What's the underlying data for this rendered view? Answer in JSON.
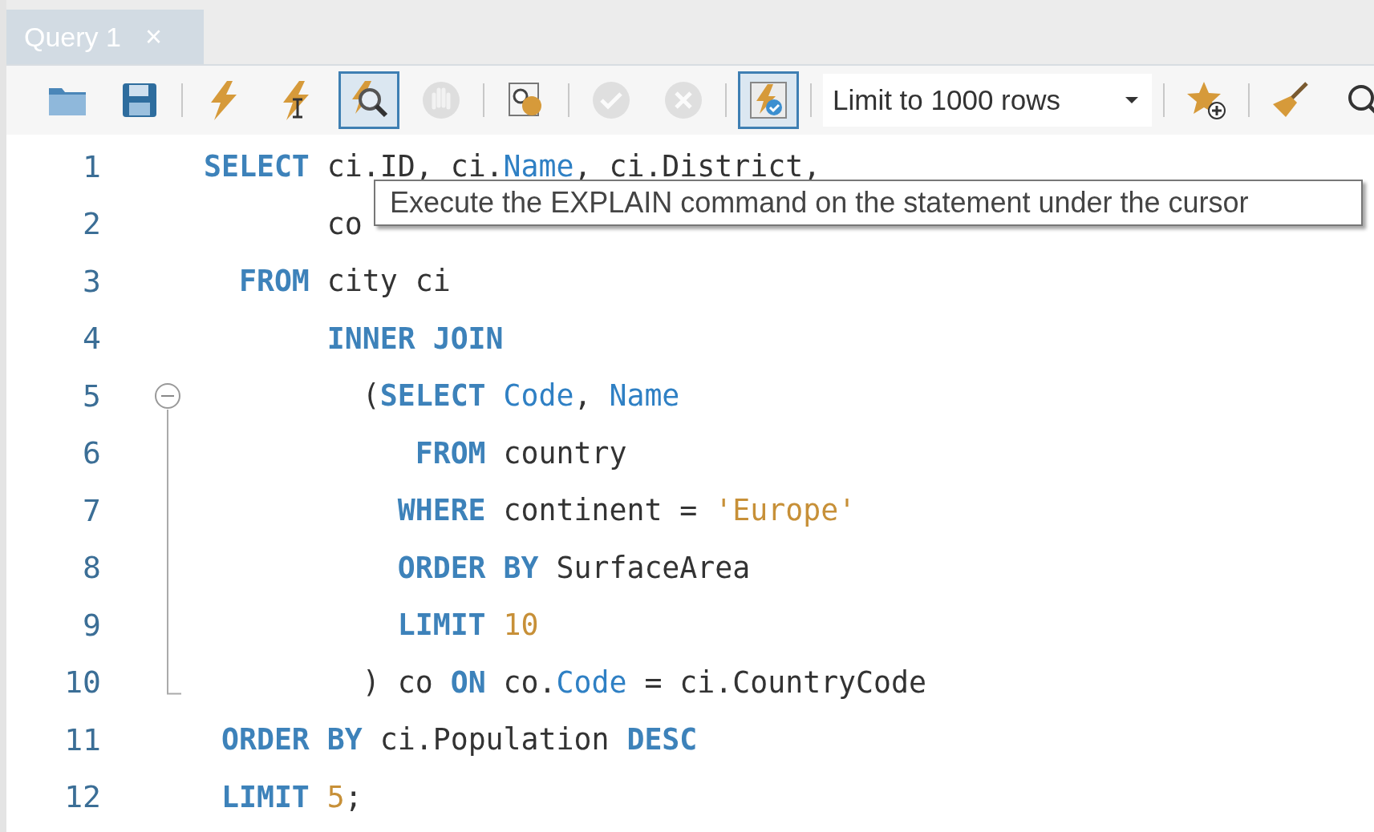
{
  "tabs": [
    {
      "label": "Query 1",
      "close": "×",
      "selected": true
    }
  ],
  "toolbar": [
    {
      "kind": "button",
      "selected": false,
      "disabled": false
    },
    {
      "kind": "button",
      "selected": false,
      "disabled": false
    },
    {
      "kind": "separator"
    },
    {
      "kind": "button",
      "selected": false,
      "disabled": false
    },
    {
      "kind": "button",
      "selected": false,
      "disabled": false
    },
    {
      "kind": "button",
      "selected": true,
      "disabled": false
    },
    {
      "kind": "button",
      "selected": false,
      "disabled": true
    },
    {
      "kind": "separator"
    },
    {
      "kind": "button",
      "selected": false,
      "disabled": false
    },
    {
      "kind": "separator"
    },
    {
      "kind": "button",
      "selected": false,
      "disabled": true
    },
    {
      "kind": "button",
      "selected": false,
      "disabled": true
    },
    {
      "kind": "separator"
    },
    {
      "kind": "button",
      "selected": true,
      "disabled": false
    },
    {
      "kind": "separator"
    },
    {
      "kind": "dropdown",
      "value": "Limit to 1000 rows"
    },
    {
      "kind": "separator"
    },
    {
      "kind": "button",
      "selected": false,
      "disabled": false
    },
    {
      "kind": "separator"
    },
    {
      "kind": "button",
      "selected": false,
      "disabled": false
    },
    {
      "kind": "button",
      "selected": false,
      "disabled": false
    }
  ],
  "editor": {
    "lines": [
      {
        "number": "1",
        "tokens": [
          {
            "kind": "keyword",
            "text": "SELECT"
          },
          {
            "kind": "text",
            "text": " ci.ID, ci."
          },
          {
            "kind": "column",
            "text": "Name"
          },
          {
            "kind": "text",
            "text": ", ci.District,"
          }
        ]
      },
      {
        "number": "2",
        "tokens": [
          {
            "kind": "text",
            "text": "       co"
          }
        ]
      },
      {
        "number": "3",
        "tokens": [
          {
            "kind": "keyword",
            "text": "  FROM"
          },
          {
            "kind": "text",
            "text": " city ci"
          }
        ]
      },
      {
        "number": "4",
        "tokens": [
          {
            "kind": "keyword",
            "text": "       INNER JOIN"
          }
        ]
      },
      {
        "number": "5",
        "expanded": true,
        "tokens": [
          {
            "kind": "text",
            "text": "         ("
          },
          {
            "kind": "keyword",
            "text": "SELECT"
          },
          {
            "kind": "column",
            "text": " Code"
          },
          {
            "kind": "text",
            "text": ", "
          },
          {
            "kind": "column",
            "text": "Name"
          }
        ],
        "children": [
          {
            "number": "6",
            "tokens": [
              {
                "kind": "keyword",
                "text": "            FROM"
              },
              {
                "kind": "text",
                "text": " country"
              }
            ]
          },
          {
            "number": "7",
            "tokens": [
              {
                "kind": "keyword",
                "text": "           WHERE"
              },
              {
                "kind": "text",
                "text": " continent = "
              },
              {
                "kind": "string",
                "text": "'Europe'"
              }
            ]
          },
          {
            "number": "8",
            "tokens": [
              {
                "kind": "keyword",
                "text": "           ORDER BY"
              },
              {
                "kind": "text",
                "text": " SurfaceArea"
              }
            ]
          },
          {
            "number": "9",
            "tokens": [
              {
                "kind": "keyword",
                "text": "           LIMIT"
              },
              {
                "kind": "number",
                "text": " 10"
              }
            ]
          },
          {
            "number": "10",
            "tokens": [
              {
                "kind": "text",
                "text": "         ) co "
              },
              {
                "kind": "keyword",
                "text": "ON"
              },
              {
                "kind": "text",
                "text": " co."
              },
              {
                "kind": "column",
                "text": "Code"
              },
              {
                "kind": "text",
                "text": " = ci.CountryCode"
              }
            ]
          }
        ]
      },
      {
        "number": "11",
        "tokens": [
          {
            "kind": "keyword",
            "text": " ORDER BY"
          },
          {
            "kind": "text",
            "text": " ci.Population "
          },
          {
            "kind": "keyword",
            "text": "DESC"
          }
        ]
      },
      {
        "number": "12",
        "tokens": [
          {
            "kind": "keyword",
            "text": " LIMIT"
          },
          {
            "kind": "number",
            "text": " 5"
          },
          {
            "kind": "text",
            "text": ";"
          }
        ]
      }
    ]
  },
  "tooltip": {
    "text": "Execute the EXPLAIN command on the statement under the cursor"
  }
}
